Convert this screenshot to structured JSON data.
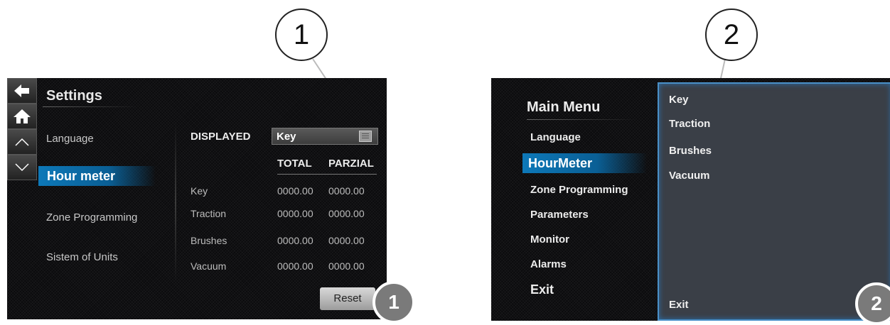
{
  "callouts": [
    {
      "number": "1"
    },
    {
      "number": "2"
    }
  ],
  "screen1": {
    "title": "Settings",
    "menu_items": [
      "Language",
      "Hour meter",
      "Zone Programming",
      "Sistem of Units"
    ],
    "selected_index": 1,
    "displayed_label": "DISPLAYED",
    "dropdown_value": "Key",
    "columns": [
      "TOTAL",
      "PARZIAL"
    ],
    "rows": [
      {
        "label": "Key",
        "total": "0000.00",
        "partial": "0000.00"
      },
      {
        "label": "Traction",
        "total": "0000.00",
        "partial": "0000.00"
      },
      {
        "label": "Brushes",
        "total": "0000.00",
        "partial": "0000.00"
      },
      {
        "label": "Vacuum",
        "total": "0000.00",
        "partial": "0000.00"
      }
    ],
    "nav_icons": [
      "back-arrow-icon",
      "home-icon",
      "up-chevron-icon",
      "down-chevron-icon"
    ],
    "reset_label": "Reset",
    "badge": "1"
  },
  "screen2": {
    "title": "Main Menu",
    "menu_items": [
      "Language",
      "HourMeter",
      "Zone Programming",
      "Parameters",
      "Monitor",
      "Alarms",
      "Exit"
    ],
    "selected_index": 1,
    "panel_items": [
      "Key",
      "Traction",
      "Brushes",
      "Vacuum"
    ],
    "panel_exit": "Exit",
    "badge": "2"
  },
  "colors": {
    "accent": "#0d78b8",
    "screen_bg": "#0b0b0d",
    "panel_bg": "#3a3f47",
    "badge_bg": "#7a7a7a"
  }
}
